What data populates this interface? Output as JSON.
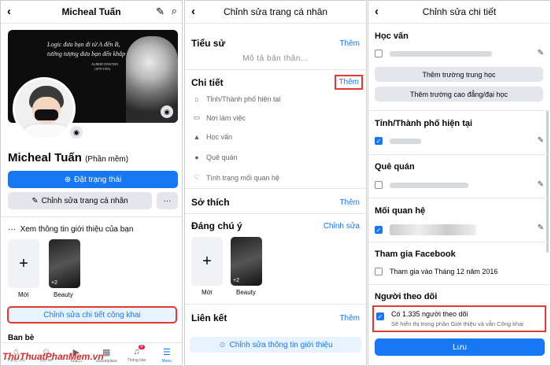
{
  "p1": {
    "title": "Micheal Tuấn",
    "cover": {
      "quote1": "Logic đưa bạn đi từ A đến B,",
      "quote2": "tưởng tượng đưa bạn đến khắp mọi nơi.",
      "author": "ALBERT EINSTEIN",
      "years": "(1879-1955)"
    },
    "name": "Micheal Tuấn",
    "alt_name": "(Phần mềm)",
    "status_btn": "Đặt trạng thái",
    "edit_profile_btn": "Chỉnh sửa trang cá nhân",
    "more_btn": "···",
    "see_intro": "Xem thông tin giới thiệu của bạn",
    "story_new": "Mới",
    "story_beauty": "Beauty",
    "story_count": "+2",
    "edit_public": "Chỉnh sửa chi tiết công khai",
    "cut_text": "Bạn bè",
    "nav": [
      "Trang chủ",
      "Bạn bè",
      "Watch",
      "Marketplace",
      "Thông báo",
      "Menu"
    ],
    "notif_count": "9"
  },
  "p2": {
    "title": "Chỉnh sửa trang cá nhân",
    "bio_h": "Tiểu sử",
    "bio_link": "Thêm",
    "bio_ph": "Mô tả bản thân...",
    "details_h": "Chi tiết",
    "details_link": "Thêm",
    "details": [
      "Tỉnh/Thành phố hiện tại",
      "Nơi làm việc",
      "Học vấn",
      "Quê quán",
      "Tình trạng mối quan hệ"
    ],
    "hobbies_h": "Sở thích",
    "hobbies_link": "Thêm",
    "featured_h": "Đáng chú ý",
    "featured_link": "Chỉnh sửa",
    "story_new": "Mới",
    "story_beauty": "Beauty",
    "story_count": "+2",
    "links_h": "Liên kết",
    "links_link": "Thêm",
    "edit_intro_btn": "Chỉnh sửa thông tin giới thiệu"
  },
  "p3": {
    "title": "Chỉnh sửa chi tiết",
    "edu_h": "Học vấn",
    "add_hs": "Thêm trường trung học",
    "add_college": "Thêm trường cao đẳng/đại học",
    "city_h": "Tỉnh/Thành phố hiện tại",
    "home_h": "Quê quán",
    "rel_h": "Mối quan hệ",
    "joined_h": "Tham gia Facebook",
    "joined_text": "Tham gia vào Tháng 12 năm 2016",
    "followers_h": "Người theo dõi",
    "followers_text": "Có 1.335 người theo dõi",
    "followers_sub": "Sẽ hiển thị trong phần Giới thiệu và vẫn Công khai",
    "save_btn": "Lưu"
  },
  "watermark": "ThuThuatPhanMem.vn",
  "colors": {
    "accent": "#1877f2",
    "highlight": "#e53935",
    "watermark": "#d32f2f"
  }
}
